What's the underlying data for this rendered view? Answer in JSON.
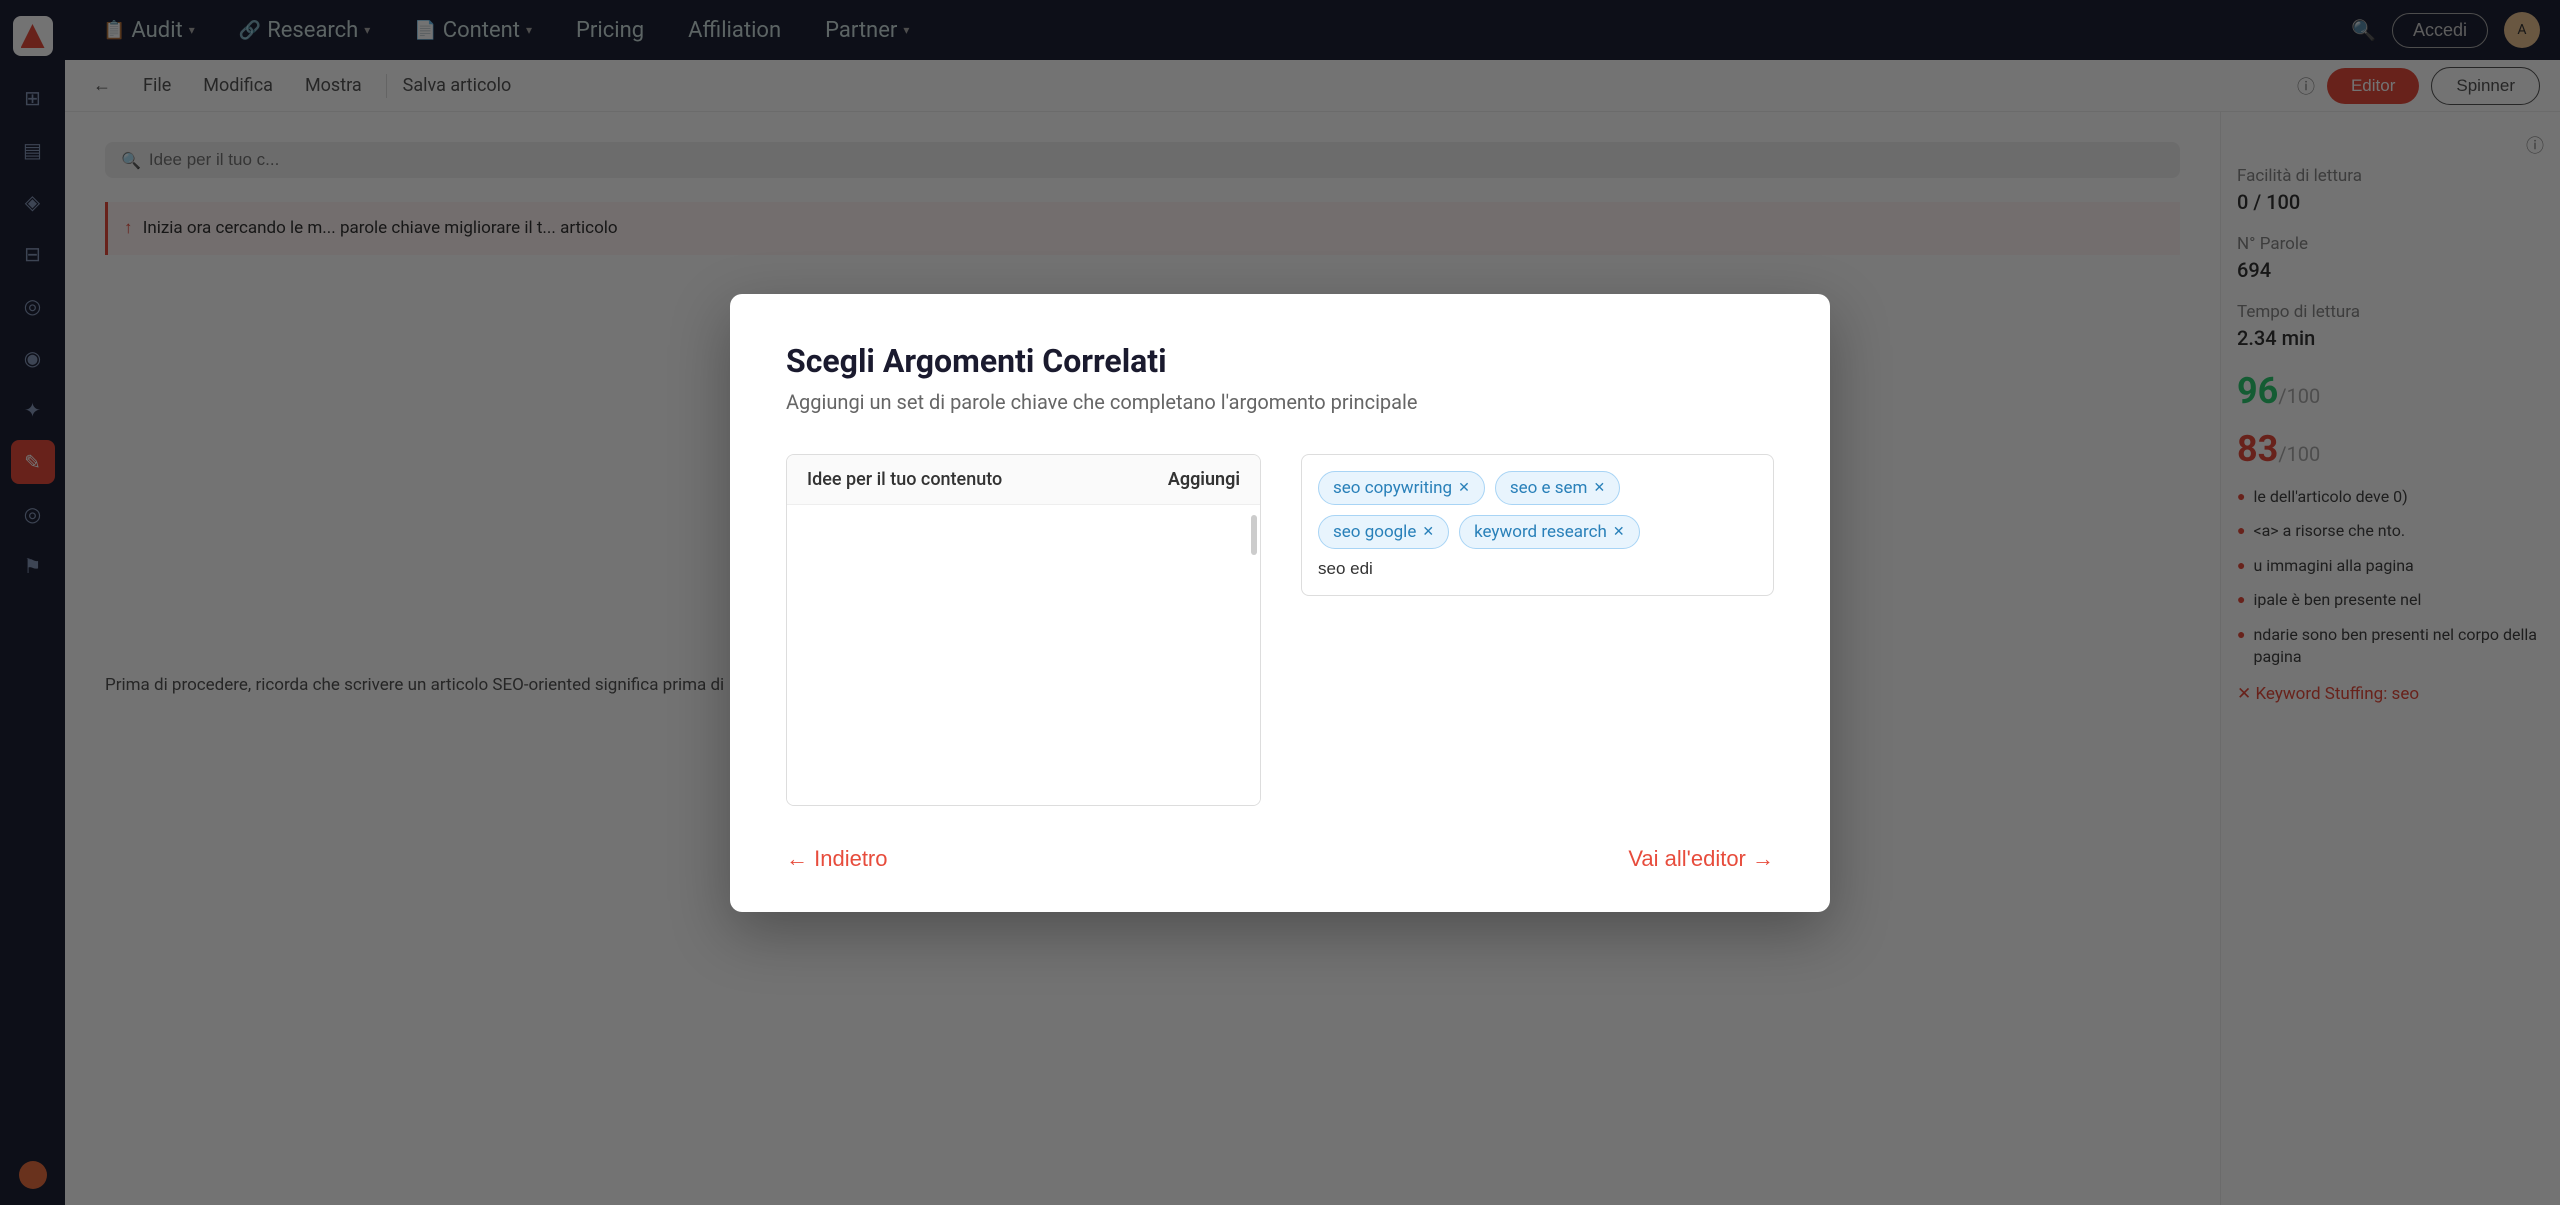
{
  "nav": {
    "items": [
      {
        "id": "audit",
        "label": "Audit",
        "icon": "📋",
        "hasChevron": true
      },
      {
        "id": "research",
        "label": "Research",
        "icon": "🔗",
        "hasChevron": true
      },
      {
        "id": "content",
        "label": "Content",
        "icon": "📄",
        "hasChevron": true
      },
      {
        "id": "pricing",
        "label": "Pricing",
        "hasChevron": false
      },
      {
        "id": "affiliation",
        "label": "Affiliation",
        "hasChevron": false
      },
      {
        "id": "partner",
        "label": "Partner",
        "hasChevron": true
      }
    ],
    "login_label": "Accedi",
    "search_icon": "🔍"
  },
  "toolbar": {
    "back_label": "←",
    "file_label": "File",
    "modifica_label": "Modifica",
    "mostra_label": "Mostra",
    "save_label": "Salva articolo",
    "editor_label": "Editor",
    "spinner_label": "Spinner"
  },
  "sidebar": {
    "icons": [
      {
        "id": "home",
        "symbol": "⊞",
        "active": false
      },
      {
        "id": "chart",
        "symbol": "📊",
        "active": false
      },
      {
        "id": "bookmark",
        "symbol": "🔖",
        "active": false
      },
      {
        "id": "grid",
        "symbol": "⊟",
        "active": false
      },
      {
        "id": "globe",
        "symbol": "🌐",
        "active": false
      },
      {
        "id": "chat",
        "symbol": "💬",
        "active": false
      },
      {
        "id": "star",
        "symbol": "★",
        "active": false
      },
      {
        "id": "pen",
        "symbol": "✏️",
        "active": true
      },
      {
        "id": "settings2",
        "symbol": "⚙",
        "active": false
      },
      {
        "id": "flag",
        "symbol": "⚑",
        "active": false
      }
    ]
  },
  "right_panel": {
    "facilita_label": "Facilità di lettura",
    "facilita_value": "0 / 100",
    "parole_label": "N° Parole",
    "parole_value": "694",
    "tempo_label": "Tempo di lettura",
    "tempo_value": "2.34 min",
    "score1": "96",
    "score1_max": "/100",
    "score2": "83",
    "score2_max": "/100",
    "tip1": "le dell'articolo deve 0)",
    "tip2": "<a>  a risorse che nto.",
    "tip3": "u immagini alla pagina",
    "tip4": "ipale è ben presente nel",
    "tip5": "ndarie sono ben presenti nel corpo della pagina",
    "alert": "Keyword Stuffing: seo"
  },
  "editor": {
    "search_placeholder": "Idee per il tuo c...",
    "content_start": "↑ Inizia ora cercando le m... parole chiave migliorare il t... articolo",
    "content_bottom": "Prima di procedere, ricorda che scrivere un articolo SEO-oriented significa prima di"
  },
  "modal": {
    "title": "Scegli Argomenti Correlati",
    "subtitle": "Aggiungi un set di parole chiave che completano l'argomento principale",
    "left_panel": {
      "header_title": "Idee per il tuo contenuto",
      "header_add": "Aggiungi"
    },
    "tags": [
      {
        "id": "tag1",
        "label": "seo copywriting"
      },
      {
        "id": "tag2",
        "label": "seo e sem"
      },
      {
        "id": "tag3",
        "label": "seo google"
      },
      {
        "id": "tag4",
        "label": "keyword research"
      }
    ],
    "input_value": "seo edi",
    "back_label": "← Indietro",
    "go_editor_label": "Vai all'editor →"
  }
}
